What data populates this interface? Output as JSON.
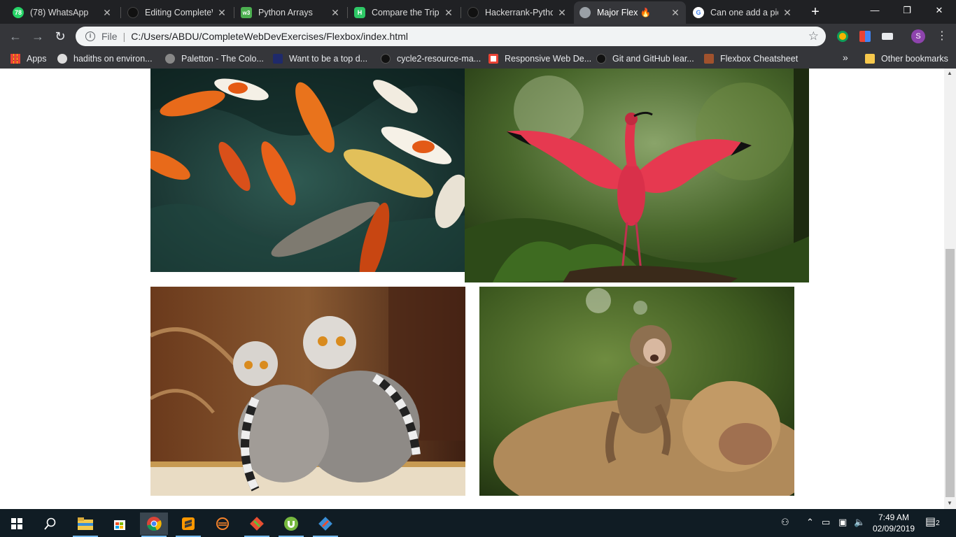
{
  "tabs": [
    {
      "title": "(78) WhatsApp",
      "favicon": "whatsapp-icon",
      "color": "#25d366",
      "badge": "78"
    },
    {
      "title": "Editing CompleteW",
      "favicon": "github-icon",
      "color": "#111111"
    },
    {
      "title": "Python Arrays",
      "favicon": "w3schools-icon",
      "color": "#4caf50",
      "badge": "w3"
    },
    {
      "title": "Compare the Triple",
      "favicon": "hackerrank-icon",
      "color": "#2ec866",
      "badge": "H"
    },
    {
      "title": "Hackerrank-Python",
      "favicon": "github-icon",
      "color": "#111111"
    },
    {
      "title": "Major Flex 🔥",
      "favicon": "globe-icon",
      "color": "#9aa0a6",
      "active": true
    },
    {
      "title": "Can one add a pic",
      "favicon": "google-icon",
      "color": "#4285f4",
      "badge": "G"
    }
  ],
  "window": {
    "minimize": "—",
    "restore": "❐",
    "close": "✕"
  },
  "toolbar": {
    "file_label": "File",
    "url": "C:/Users/ABDU/CompleteWebDevExercises/Flexbox/index.html",
    "profile_initial": "S"
  },
  "bookmarks": [
    {
      "label": "Apps",
      "icon": "apps-grid-icon",
      "color": "#ea4335"
    },
    {
      "label": "hadiths on environ...",
      "icon": "globe-icon",
      "color": "#dddddd"
    },
    {
      "label": "Paletton - The Colo...",
      "icon": "paletton-icon",
      "color": "#888888"
    },
    {
      "label": "Want to be a top d...",
      "icon": "codeacademy-icon",
      "color": "#1f2a6b"
    },
    {
      "label": "cycle2-resource-ma...",
      "icon": "github-icon",
      "color": "#111111"
    },
    {
      "label": "Responsive Web De...",
      "icon": "freecodecamp-icon",
      "color": "#ffffff"
    },
    {
      "label": "Git and GitHub lear...",
      "icon": "github-icon",
      "color": "#111111"
    },
    {
      "label": "Flexbox Cheatsheet",
      "icon": "cheatsheet-icon",
      "color": "#a0522d"
    }
  ],
  "bookmarks_more": "»",
  "other_bookmarks": "Other bookmarks",
  "images": [
    {
      "subject": "koi-fish",
      "dominant": "#1e3a36"
    },
    {
      "subject": "scarlet-ibis",
      "dominant": "#4d6b2a"
    },
    {
      "subject": "ring-tailed-lemurs",
      "dominant": "#5a3220"
    },
    {
      "subject": "barbary-macaques",
      "dominant": "#3f5a22"
    }
  ],
  "taskbar": {
    "time": "7:49 AM",
    "date": "02/09/2019",
    "notifications": "2",
    "apps": [
      "start-icon",
      "search-icon",
      "file-explorer-icon",
      "store-icon",
      "chrome-icon",
      "sublime-icon",
      "eclipse-icon",
      "git-icon",
      "utorrent-icon",
      "git-gui-icon"
    ]
  }
}
